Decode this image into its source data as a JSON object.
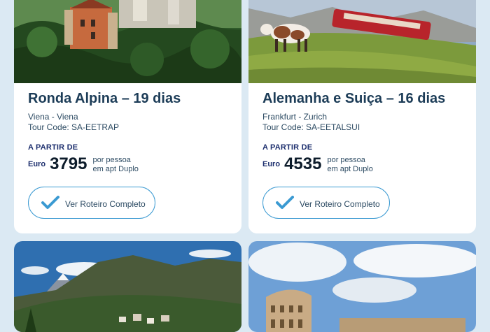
{
  "tours": [
    {
      "title": "Ronda Alpina – 19 dias",
      "route": "Viena - Viena",
      "tour_code": "Tour Code: SA-EETRAP",
      "from_label": "A PARTIR DE",
      "currency": "Euro",
      "price": "3795",
      "per_line1": "por pessoa",
      "per_line2": "em apt Duplo",
      "button_label": "Ver Roteiro Completo",
      "image": "neuschwanstein-castle-photo"
    },
    {
      "title": "Alemanha e Suiça – 16 dias",
      "route": "Frankfurt - Zurich",
      "tour_code": "Tour Code: SA-EETALSUI",
      "from_label": "A PARTIR DE",
      "currency": "Euro",
      "price": "4535",
      "per_line1": "por pessoa",
      "per_line2": "em apt Duplo",
      "button_label": "Ver Roteiro Completo",
      "image": "swiss-train-cow-photo"
    },
    {
      "image": "matterhorn-village-photo"
    },
    {
      "image": "colosseum-rome-photo"
    }
  ],
  "colors": {
    "background": "#dbe9f3",
    "title": "#1c3c57",
    "accent": "#3b9ad2",
    "label_dark": "#1d2f6e"
  },
  "icons": {
    "button": "checkmark-icon"
  }
}
